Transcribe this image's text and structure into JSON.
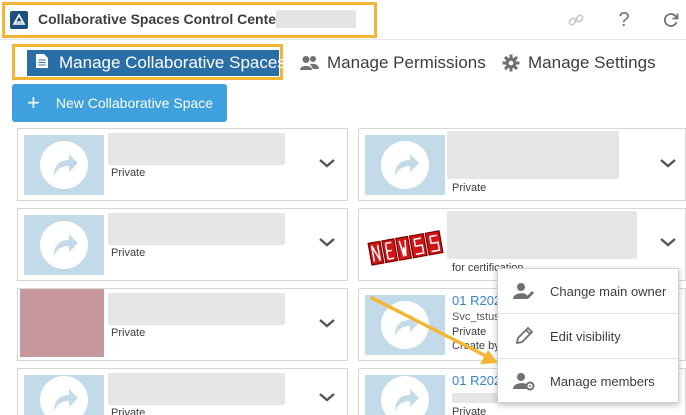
{
  "window": {
    "title": "Collaborative Spaces Control Center -"
  },
  "header": {
    "icons": [
      "link-icon",
      "help-icon",
      "refresh-icon"
    ],
    "help_glyph": "?"
  },
  "tabs": [
    {
      "label": "Manage Collaborative Spaces",
      "icon": "document-icon",
      "active": true
    },
    {
      "label": "Manage Permissions",
      "icon": "users-icon",
      "active": false
    },
    {
      "label": "Manage Settings",
      "icon": "gear-icon",
      "active": false
    }
  ],
  "toolbar": {
    "new_space_label": "New Collaborative Space",
    "new_space_plus": "+"
  },
  "cards": [
    {
      "visibility": "Private"
    },
    {
      "visibility": "Private"
    },
    {
      "visibility": "Private"
    },
    {
      "visibility": "for certification"
    },
    {
      "visibility": "Private"
    },
    {
      "title": "01 R202",
      "owner": "Svc_tstus",
      "visibility": "Private",
      "created": "Create by"
    },
    {
      "visibility": "Private"
    },
    {
      "title": "01 R202",
      "visibility": "Private"
    }
  ],
  "context_menu": {
    "items": [
      {
        "label": "Change main owner",
        "icon": "user-edit-icon"
      },
      {
        "label": "Edit visibility",
        "icon": "pencil-icon"
      },
      {
        "label": "Manage members",
        "icon": "user-settings-icon"
      }
    ]
  },
  "colors": {
    "accent": "#2a6ea8",
    "button": "#3ea0dc",
    "highlight": "#f2b632",
    "thumbnail": "#c3dbe9",
    "link": "#3883c4"
  }
}
